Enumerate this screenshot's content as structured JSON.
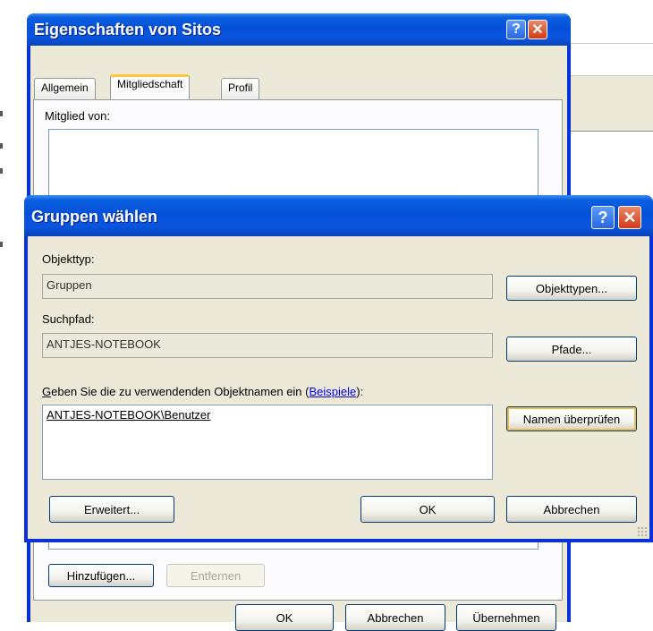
{
  "back_dialog": {
    "title": "Eigenschaften von Sitos",
    "tabs": [
      {
        "label": "Allgemein"
      },
      {
        "label": "Mitgliedschaft"
      },
      {
        "label": "Profil"
      }
    ],
    "member_of_label": "Mitglied von:",
    "add_button": "Hinzufügen...",
    "remove_button": "Entfernen",
    "ok_button": "OK",
    "cancel_button": "Abbrechen",
    "apply_button": "Übernehmen",
    "help_glyph": "?",
    "close_glyph": "✕"
  },
  "select_dialog": {
    "title": "Gruppen wählen",
    "object_type_label": "Objekttyp:",
    "object_type_value": "Gruppen",
    "object_types_button": "Objekttypen...",
    "search_path_label": "Suchpfad:",
    "search_path_value": "ANTJES-NOTEBOOK",
    "paths_button": "Pfade...",
    "names_prompt_lead": "G",
    "names_prompt_main": "eben Sie die zu verwendenden Objektnamen ein (",
    "examples_link": "Beispiele",
    "names_prompt_tail": "):",
    "names_value": "ANTJES-NOTEBOOK\\Benutzer",
    "check_names_button": "Namen überprüfen",
    "advanced_button": "Erweitert...",
    "ok_button": "OK",
    "cancel_button": "Abbrechen",
    "help_glyph": "?",
    "close_glyph": "✕"
  },
  "icons": {
    "help": "question-mark",
    "close": "x-mark",
    "resize": "size-grip"
  }
}
